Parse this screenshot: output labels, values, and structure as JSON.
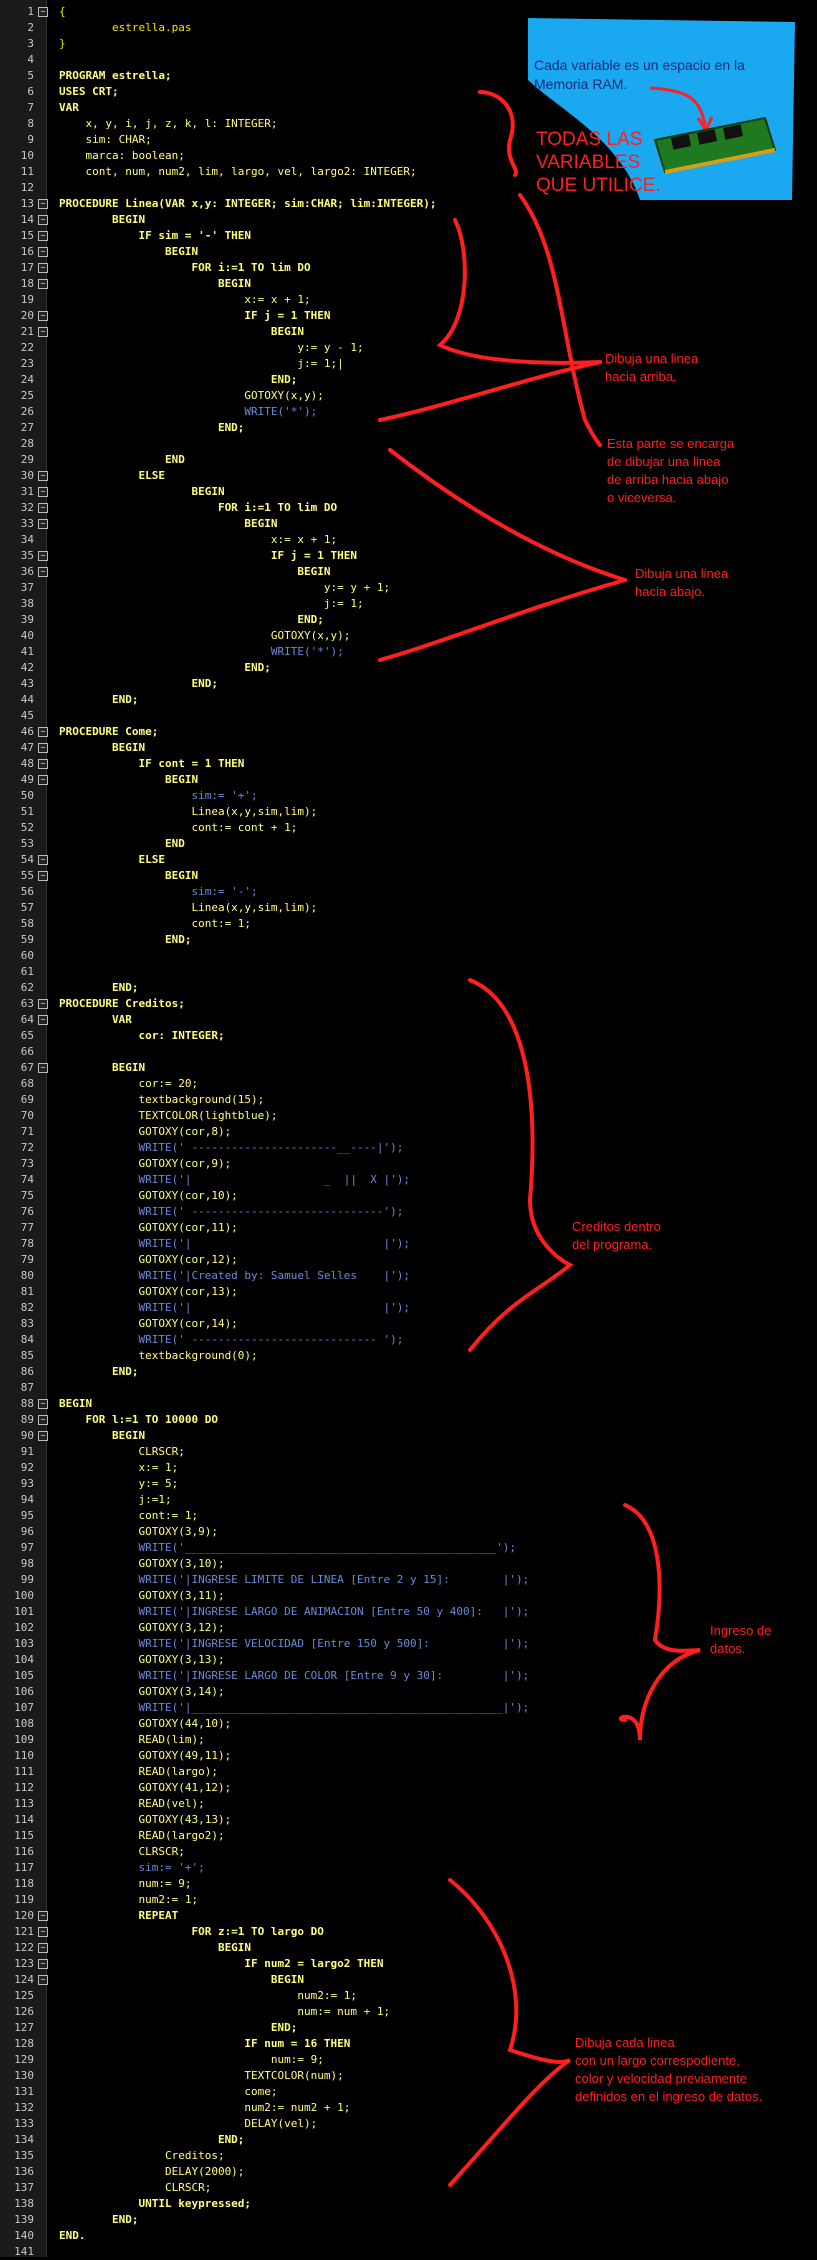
{
  "file_title": "estrella.pas",
  "lines": [
    {
      "n": 1,
      "t": "{",
      "c": "comment"
    },
    {
      "n": 2,
      "t": "        estrella.pas",
      "c": "comment"
    },
    {
      "n": 3,
      "t": "}",
      "c": "comment"
    },
    {
      "n": 4,
      "t": ""
    },
    {
      "n": 5,
      "t": "PROGRAM estrella;",
      "c": "kw"
    },
    {
      "n": 6,
      "t": "USES CRT;",
      "c": "kw"
    },
    {
      "n": 7,
      "t": "VAR",
      "c": "kw"
    },
    {
      "n": 8,
      "t": "    x, y, i, j, z, k, l: INTEGER;"
    },
    {
      "n": 9,
      "t": "    sim: CHAR;"
    },
    {
      "n": 10,
      "t": "    marca: boolean;"
    },
    {
      "n": 11,
      "t": "    cont, num, num2, lim, largo, vel, largo2: INTEGER;"
    },
    {
      "n": 12,
      "t": ""
    },
    {
      "n": 13,
      "t": "PROCEDURE Linea(VAR x,y: INTEGER; sim:CHAR; lim:INTEGER);",
      "c": "kw"
    },
    {
      "n": 14,
      "t": "        BEGIN",
      "c": "kw"
    },
    {
      "n": 15,
      "t": "            IF sim = '-' THEN",
      "c": "kw"
    },
    {
      "n": 16,
      "t": "                BEGIN",
      "c": "kw"
    },
    {
      "n": 17,
      "t": "                    FOR i:=1 TO lim DO",
      "c": "kw"
    },
    {
      "n": 18,
      "t": "                        BEGIN",
      "c": "kw"
    },
    {
      "n": 19,
      "t": "                            x:= x + 1;"
    },
    {
      "n": 20,
      "t": "                            IF j = 1 THEN",
      "c": "kw"
    },
    {
      "n": 21,
      "t": "                                BEGIN",
      "c": "kw"
    },
    {
      "n": 22,
      "t": "                                    y:= y - 1;"
    },
    {
      "n": 23,
      "t": "                                    j:= 1;|"
    },
    {
      "n": 24,
      "t": "                                END;",
      "c": "kw"
    },
    {
      "n": 25,
      "t": "                            GOTOXY(x,y);"
    },
    {
      "n": 26,
      "t": "                            WRITE('*');"
    },
    {
      "n": 27,
      "t": "                        END;",
      "c": "kw"
    },
    {
      "n": 28,
      "t": ""
    },
    {
      "n": 29,
      "t": "                END",
      "c": "kw"
    },
    {
      "n": 30,
      "t": "            ELSE",
      "c": "kw"
    },
    {
      "n": 31,
      "t": "                    BEGIN",
      "c": "kw"
    },
    {
      "n": 32,
      "t": "                        FOR i:=1 TO lim DO",
      "c": "kw"
    },
    {
      "n": 33,
      "t": "                            BEGIN",
      "c": "kw"
    },
    {
      "n": 34,
      "t": "                                x:= x + 1;"
    },
    {
      "n": 35,
      "t": "                                IF j = 1 THEN",
      "c": "kw"
    },
    {
      "n": 36,
      "t": "                                    BEGIN",
      "c": "kw"
    },
    {
      "n": 37,
      "t": "                                        y:= y + 1;"
    },
    {
      "n": 38,
      "t": "                                        j:= 1;"
    },
    {
      "n": 39,
      "t": "                                    END;",
      "c": "kw"
    },
    {
      "n": 40,
      "t": "                                GOTOXY(x,y);"
    },
    {
      "n": 41,
      "t": "                                WRITE('*');"
    },
    {
      "n": 42,
      "t": "                            END;",
      "c": "kw"
    },
    {
      "n": 43,
      "t": "                    END;",
      "c": "kw"
    },
    {
      "n": 44,
      "t": "        END;",
      "c": "kw"
    },
    {
      "n": 45,
      "t": ""
    },
    {
      "n": 46,
      "t": "PROCEDURE Come;",
      "c": "kw"
    },
    {
      "n": 47,
      "t": "        BEGIN",
      "c": "kw"
    },
    {
      "n": 48,
      "t": "            IF cont = 1 THEN",
      "c": "kw"
    },
    {
      "n": 49,
      "t": "                BEGIN",
      "c": "kw"
    },
    {
      "n": 50,
      "t": "                    sim:= '+';"
    },
    {
      "n": 51,
      "t": "                    Linea(x,y,sim,lim);"
    },
    {
      "n": 52,
      "t": "                    cont:= cont + 1;"
    },
    {
      "n": 53,
      "t": "                END",
      "c": "kw"
    },
    {
      "n": 54,
      "t": "            ELSE",
      "c": "kw"
    },
    {
      "n": 55,
      "t": "                BEGIN",
      "c": "kw"
    },
    {
      "n": 56,
      "t": "                    sim:= '-';"
    },
    {
      "n": 57,
      "t": "                    Linea(x,y,sim,lim);"
    },
    {
      "n": 58,
      "t": "                    cont:= 1;"
    },
    {
      "n": 59,
      "t": "                END;",
      "c": "kw"
    },
    {
      "n": 60,
      "t": ""
    },
    {
      "n": 61,
      "t": ""
    },
    {
      "n": 62,
      "t": "        END;",
      "c": "kw"
    },
    {
      "n": 63,
      "t": "PROCEDURE Creditos;",
      "c": "kw"
    },
    {
      "n": 64,
      "t": "        VAR",
      "c": "kw"
    },
    {
      "n": 65,
      "t": "            cor: INTEGER;",
      "c": "kw"
    },
    {
      "n": 66,
      "t": ""
    },
    {
      "n": 67,
      "t": "        BEGIN",
      "c": "kw"
    },
    {
      "n": 68,
      "t": "            cor:= 20;"
    },
    {
      "n": 69,
      "t": "            textbackground(15);"
    },
    {
      "n": 70,
      "t": "            TEXTCOLOR(lightblue);"
    },
    {
      "n": 71,
      "t": "            GOTOXY(cor,8);"
    },
    {
      "n": 72,
      "t": "            WRITE(' ----------------------__----|');"
    },
    {
      "n": 73,
      "t": "            GOTOXY(cor,9);"
    },
    {
      "n": 74,
      "t": "            WRITE('|                    _  ||  X |');"
    },
    {
      "n": 75,
      "t": "            GOTOXY(cor,10);"
    },
    {
      "n": 76,
      "t": "            WRITE(' -----------------------------');"
    },
    {
      "n": 77,
      "t": "            GOTOXY(cor,11);"
    },
    {
      "n": 78,
      "t": "            WRITE('|                             |');"
    },
    {
      "n": 79,
      "t": "            GOTOXY(cor,12);"
    },
    {
      "n": 80,
      "t": "            WRITE('|Created by: Samuel Selles    |');"
    },
    {
      "n": 81,
      "t": "            GOTOXY(cor,13);"
    },
    {
      "n": 82,
      "t": "            WRITE('|                             |');"
    },
    {
      "n": 83,
      "t": "            GOTOXY(cor,14);"
    },
    {
      "n": 84,
      "t": "            WRITE(' ---------------------------- ');"
    },
    {
      "n": 85,
      "t": "            textbackground(0);"
    },
    {
      "n": 86,
      "t": "        END;",
      "c": "kw"
    },
    {
      "n": 87,
      "t": ""
    },
    {
      "n": 88,
      "t": "BEGIN",
      "c": "kw"
    },
    {
      "n": 89,
      "t": "    FOR l:=1 TO 10000 DO",
      "c": "kw"
    },
    {
      "n": 90,
      "t": "        BEGIN",
      "c": "kw"
    },
    {
      "n": 91,
      "t": "            CLRSCR;"
    },
    {
      "n": 92,
      "t": "            x:= 1;"
    },
    {
      "n": 93,
      "t": "            y:= 5;"
    },
    {
      "n": 94,
      "t": "            j:=1;"
    },
    {
      "n": 95,
      "t": "            cont:= 1;"
    },
    {
      "n": 96,
      "t": "            GOTOXY(3,9);"
    },
    {
      "n": 97,
      "t": "            WRITE('_______________________________________________');"
    },
    {
      "n": 98,
      "t": "            GOTOXY(3,10);"
    },
    {
      "n": 99,
      "t": "            WRITE('|INGRESE LIMITE DE LINEA [Entre 2 y 15]:        |');"
    },
    {
      "n": 100,
      "t": "            GOTOXY(3,11);"
    },
    {
      "n": 101,
      "t": "            WRITE('|INGRESE LARGO DE ANIMACION [Entre 50 y 400]:   |');"
    },
    {
      "n": 102,
      "t": "            GOTOXY(3,12);"
    },
    {
      "n": 103,
      "t": "            WRITE('|INGRESE VELOCIDAD [Entre 150 y 500]:           |');"
    },
    {
      "n": 104,
      "t": "            GOTOXY(3,13);"
    },
    {
      "n": 105,
      "t": "            WRITE('|INGRESE LARGO DE COLOR [Entre 9 y 30]:         |');"
    },
    {
      "n": 106,
      "t": "            GOTOXY(3,14);"
    },
    {
      "n": 107,
      "t": "            WRITE('|_______________________________________________|');"
    },
    {
      "n": 108,
      "t": "            GOTOXY(44,10);"
    },
    {
      "n": 109,
      "t": "            READ(lim);"
    },
    {
      "n": 110,
      "t": "            GOTOXY(49,11);"
    },
    {
      "n": 111,
      "t": "            READ(largo);"
    },
    {
      "n": 112,
      "t": "            GOTOXY(41,12);"
    },
    {
      "n": 113,
      "t": "            READ(vel);"
    },
    {
      "n": 114,
      "t": "            GOTOXY(43,13);"
    },
    {
      "n": 115,
      "t": "            READ(largo2);"
    },
    {
      "n": 116,
      "t": "            CLRSCR;"
    },
    {
      "n": 117,
      "t": "            sim:= '+';"
    },
    {
      "n": 118,
      "t": "            num:= 9;"
    },
    {
      "n": 119,
      "t": "            num2:= 1;"
    },
    {
      "n": 120,
      "t": "            REPEAT",
      "c": "kw"
    },
    {
      "n": 121,
      "t": "                    FOR z:=1 TO largo DO",
      "c": "kw"
    },
    {
      "n": 122,
      "t": "                        BEGIN",
      "c": "kw"
    },
    {
      "n": 123,
      "t": "                            IF num2 = largo2 THEN",
      "c": "kw"
    },
    {
      "n": 124,
      "t": "                                BEGIN",
      "c": "kw"
    },
    {
      "n": 125,
      "t": "                                    num2:= 1;"
    },
    {
      "n": 126,
      "t": "                                    num:= num + 1;"
    },
    {
      "n": 127,
      "t": "                                END;",
      "c": "kw"
    },
    {
      "n": 128,
      "t": "                            IF num = 16 THEN",
      "c": "kw"
    },
    {
      "n": 129,
      "t": "                                num:= 9;"
    },
    {
      "n": 130,
      "t": "                            TEXTCOLOR(num);"
    },
    {
      "n": 131,
      "t": "                            come;"
    },
    {
      "n": 132,
      "t": "                            num2:= num2 + 1;"
    },
    {
      "n": 133,
      "t": "                            DELAY(vel);"
    },
    {
      "n": 134,
      "t": "                        END;",
      "c": "kw"
    },
    {
      "n": 135,
      "t": "                Creditos;"
    },
    {
      "n": 136,
      "t": "                DELAY(2000);"
    },
    {
      "n": 137,
      "t": "                CLRSCR;"
    },
    {
      "n": 138,
      "t": "            UNTIL keypressed;",
      "c": "kw"
    },
    {
      "n": 139,
      "t": "        END;",
      "c": "kw"
    },
    {
      "n": 140,
      "t": "END.",
      "c": "kw"
    },
    {
      "n": 141,
      "t": ""
    }
  ],
  "callout_text": "Cada variable es un espacio en la\nMemoria RAM.",
  "annotations": {
    "vars": "TODAS LAS\nVARIABLES\nQUE UTILICE.",
    "up": "Dibuja una linea\nhacia arriba.",
    "updown": "Esta parte se encarga\nde dibujar una linea\nde arriba hacia abajo\no viceversa.",
    "down": "Dibuja una linea\nhacia abajo.",
    "credits": "Creditos dentro\ndel programa.",
    "input": "Ingreso de\ndatos.",
    "loop": "Dibuja cada linea\ncon un largo correspodiente,\ncolor y velocidad previamente\ndefinidos en el ingreso de datos."
  },
  "colors": {
    "background": "#000000",
    "code_text": "#ffff7a",
    "string_text": "#6a8ad8",
    "annotation": "#ff1f1f",
    "callout_bg": "#1aa8f0"
  },
  "icons": [
    "ram-module-icon",
    "fold-toggle-icon"
  ]
}
